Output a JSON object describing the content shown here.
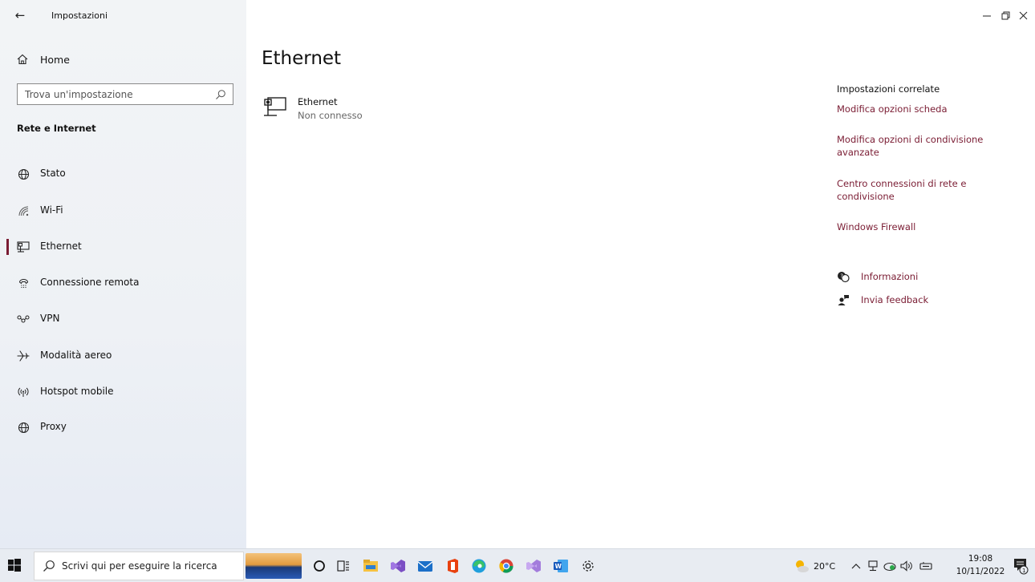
{
  "window": {
    "title": "Impostazioni",
    "back_glyph": "←",
    "controls": [
      "minimize-icon",
      "restore-icon",
      "close-icon"
    ]
  },
  "sidebar": {
    "home_label": "Home",
    "search_placeholder": "Trova un'impostazione",
    "section_title": "Rete e Internet",
    "items": [
      {
        "label": "Stato",
        "icon": "globe-status-icon",
        "selected": false
      },
      {
        "label": "Wi-Fi",
        "icon": "wifi-icon",
        "selected": false
      },
      {
        "label": "Ethernet",
        "icon": "ethernet-icon",
        "selected": true
      },
      {
        "label": "Connessione remota",
        "icon": "dialup-icon",
        "selected": false
      },
      {
        "label": "VPN",
        "icon": "vpn-icon",
        "selected": false
      },
      {
        "label": "Modalità aereo",
        "icon": "airplane-icon",
        "selected": false
      },
      {
        "label": "Hotspot mobile",
        "icon": "hotspot-icon",
        "selected": false
      },
      {
        "label": "Proxy",
        "icon": "proxy-globe-icon",
        "selected": false
      }
    ]
  },
  "main": {
    "title": "Ethernet",
    "device": {
      "name": "Ethernet",
      "status": "Non connesso"
    }
  },
  "related": {
    "title": "Impostazioni correlate",
    "links": [
      "Modifica opzioni scheda",
      "Modifica opzioni di condivisione avanzate",
      "Centro connessioni di rete e condivisione",
      "Windows Firewall"
    ],
    "help": [
      {
        "label": "Informazioni",
        "icon": "help-chat-icon"
      },
      {
        "label": "Invia feedback",
        "icon": "feedback-icon"
      }
    ]
  },
  "taskbar": {
    "search_placeholder": "Scrivi qui per eseguire la ricerca",
    "weather_temp": "20°C",
    "time": "19:08",
    "date": "10/11/2022",
    "notification_count": "1"
  },
  "colors": {
    "accent": "#7a1c33",
    "sidebar_bg": "#f2f4f6",
    "taskbar_bg": "#e8ecf2"
  }
}
